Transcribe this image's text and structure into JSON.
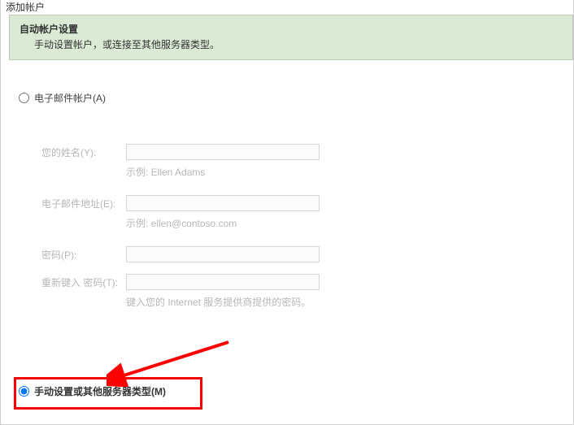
{
  "window": {
    "title": "添加帐户"
  },
  "header": {
    "title": "自动帐户设置",
    "subtitle": "手动设置帐户，或连接至其他服务器类型。"
  },
  "options": {
    "email_account_label": "电子邮件帐户(A)",
    "manual_label": "手动设置或其他服务器类型(M)"
  },
  "form": {
    "name_label": "您的姓名(Y):",
    "name_hint": "示例: Ellen Adams",
    "email_label": "电子邮件地址(E):",
    "email_hint": "示例: ellen@contoso.com",
    "password_label": "密码(P):",
    "retype_label": "重新键入 密码(T):",
    "password_hint": "键入您的 Internet 服务提供商提供的密码。"
  }
}
